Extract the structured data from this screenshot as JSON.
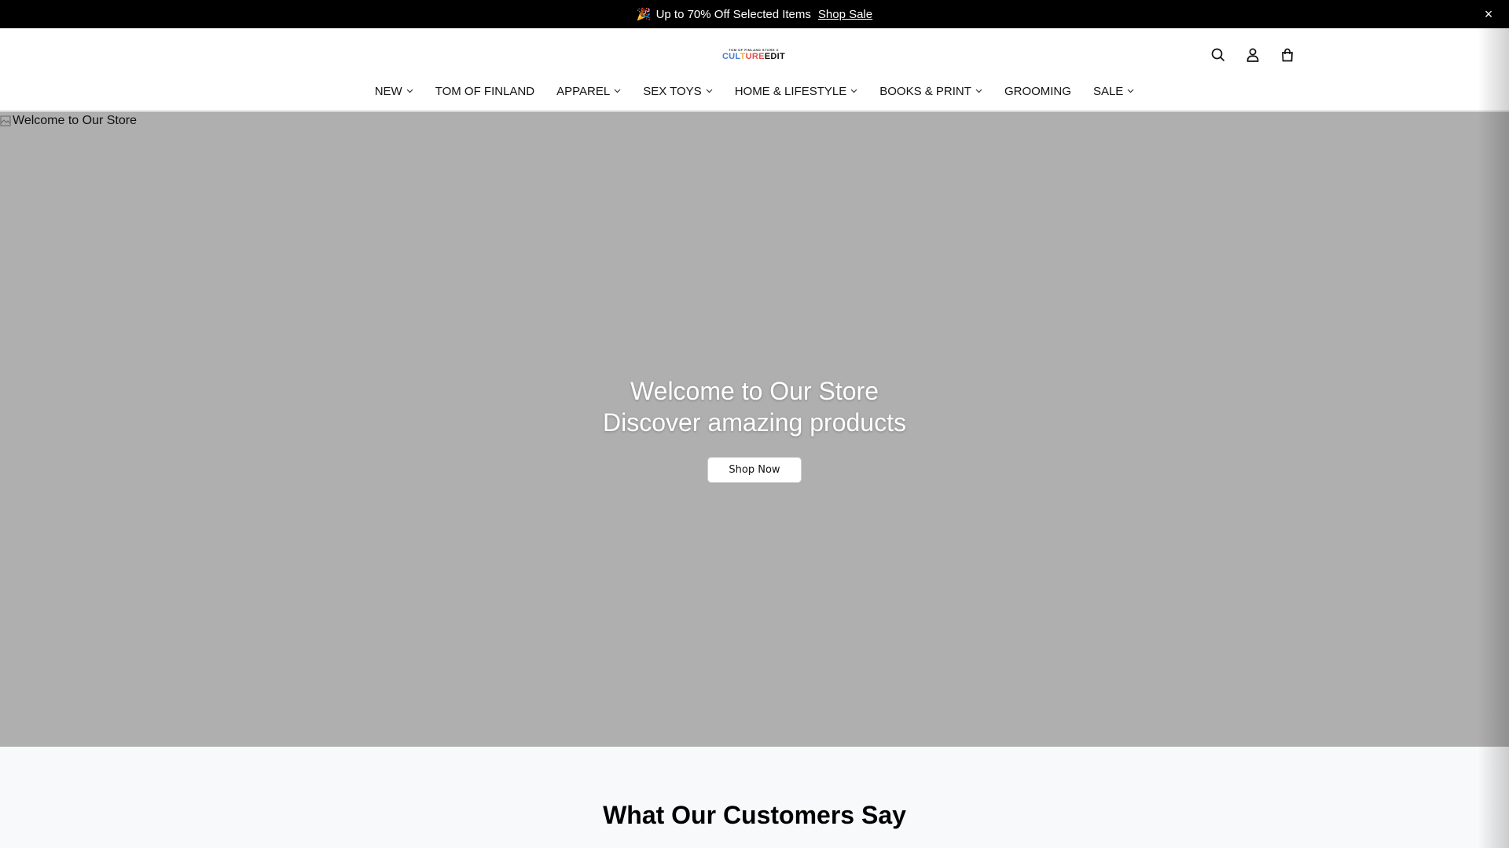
{
  "announcement": {
    "emoji": "🎉",
    "text": "Up to 70% Off Selected Items",
    "link": "Shop Sale",
    "close": "×"
  },
  "logo": {
    "tagline": "TOM OF FINLAND STORE X",
    "word_parts": [
      "CUL",
      "T",
      "URE",
      "EDIT"
    ],
    "word_colors": [
      "#4a7bd6",
      "#f2b233",
      "#e2504a",
      "#111111"
    ]
  },
  "header_icons": [
    "search-icon",
    "account-icon",
    "cart-icon"
  ],
  "nav": {
    "items": [
      {
        "label": "NEW",
        "dropdown": true
      },
      {
        "label": "TOM OF FINLAND",
        "dropdown": false
      },
      {
        "label": "APPAREL",
        "dropdown": true
      },
      {
        "label": "SEX TOYS",
        "dropdown": true
      },
      {
        "label": "HOME & LIFESTYLE",
        "dropdown": true
      },
      {
        "label": "BOOKS & PRINT",
        "dropdown": true
      },
      {
        "label": "GROOMING",
        "dropdown": false
      },
      {
        "label": "SALE",
        "dropdown": true
      }
    ]
  },
  "hero": {
    "image_alt": "Welcome to Our Store",
    "title": "Welcome to Our Store",
    "subtitle": "Discover amazing products",
    "button": "Shop Now",
    "bg_color": "#afafaf"
  },
  "testimonials": {
    "heading": "What Our Customers Say"
  }
}
